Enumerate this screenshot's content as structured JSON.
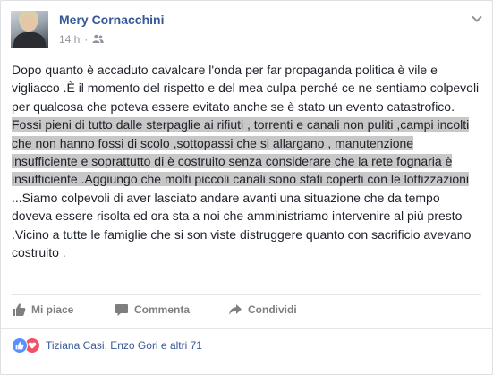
{
  "post": {
    "author": "Mery Cornacchini",
    "time": "14 h",
    "privacy_icon": "friends-icon",
    "text": {
      "part1": "Dopo quanto è accaduto cavalcare l'onda per far propaganda politica è vile e vigliacco .È il momento del rispetto e del mea culpa perché ce ne sentiamo colpevoli per qualcosa che poteva essere evitato anche se è stato un evento catastrofico. ",
      "highlighted": "Fossi pieni di tutto dalle sterpaglie ai rifiuti , torrenti e canali non puliti ,campi incolti che non hanno fossi di scolo ,sottopassi che si allargano , manutenzione insufficiente e soprattutto di è costruito senza considerare che la rete fognaria è insufficiente .Aggiungo che molti piccoli canali sono stati coperti con le lottizzazioni ",
      "part2": "...Siamo colpevoli di aver lasciato andare avanti una situazione che da tempo doveva essere risolta ed ora sta a noi che amministriamo intervenire al più presto .Vicino a tutte le famiglie che si son viste distruggere quanto con sacrificio avevano costruito ."
    }
  },
  "actions": {
    "like": "Mi piace",
    "comment": "Commenta",
    "share": "Condividi"
  },
  "reactions": {
    "icons": [
      "like-icon",
      "love-icon"
    ],
    "summary": "Tiziana Casi, Enzo Gori e altri 71"
  },
  "colors": {
    "link": "#365899",
    "highlight": "#c8c8c8",
    "like": "#5890ff",
    "love": "#f25268"
  }
}
